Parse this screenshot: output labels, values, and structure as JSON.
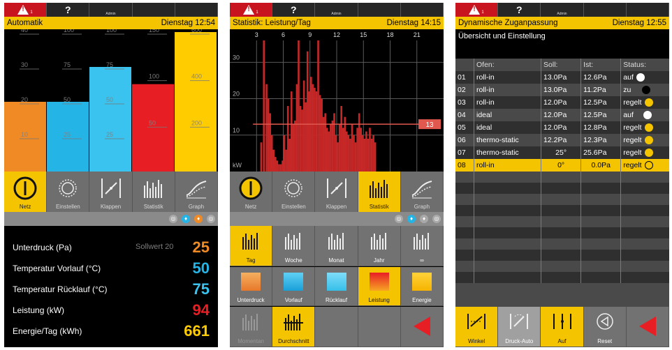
{
  "topbar": {
    "alert_sub": "1",
    "help": "?",
    "user": "Admin"
  },
  "colors": {
    "accent": "#f5c400",
    "orange": "#f08a24",
    "blue": "#25b4e6",
    "red": "#e81e25",
    "yellow": "#ffcc00"
  },
  "panel1": {
    "title": "Automatik",
    "datetime": "Dienstag 12:54",
    "bars": [
      {
        "label": "Unterdruck",
        "value": 20,
        "max": 40,
        "color": "#f08a24"
      },
      {
        "label": "Vorlauf",
        "value": 50,
        "max": 100,
        "color": "#25b4e6"
      },
      {
        "label": "Rücklauf",
        "value": 75,
        "max": 100,
        "color": "#39c3ee"
      },
      {
        "label": "Leistung",
        "value": 94,
        "max": 150,
        "color": "#e81e25"
      },
      {
        "label": "Energie",
        "value": 661,
        "max": 600,
        "color": "#ffcc00"
      }
    ],
    "bar_ticks": [
      [
        "10",
        "20",
        "30",
        "40"
      ],
      [
        "25",
        "50",
        "75",
        "100"
      ],
      [
        "25",
        "50",
        "75",
        "100"
      ],
      [
        "50",
        "100",
        "150"
      ],
      [
        "200",
        "400",
        "600"
      ]
    ],
    "nav": [
      "Netz",
      "Einstellen",
      "Klappen",
      "Statistik",
      "Graph"
    ],
    "values": [
      {
        "label": "Unterdruck (Pa)",
        "setpoint": "Sollwert 20",
        "value": "25",
        "color": "#f08a24"
      },
      {
        "label": "Temperatur Vorlauf (°C)",
        "setpoint": "",
        "value": "50",
        "color": "#25b4e6"
      },
      {
        "label": "Temperatur Rücklauf (°C)",
        "setpoint": "",
        "value": "75",
        "color": "#39c3ee"
      },
      {
        "label": "Leistung (kW)",
        "setpoint": "",
        "value": "94",
        "color": "#e81e25"
      },
      {
        "label": "Energie/Tag (kWh)",
        "setpoint": "",
        "value": "661",
        "color": "#ffcc00"
      }
    ]
  },
  "panel2": {
    "title": "Statistik: Leistung/Tag",
    "datetime": "Dienstag 14:15",
    "nav": [
      "Netz",
      "Einstellen",
      "Klappen",
      "Statistik",
      "Graph"
    ],
    "periods": [
      "Tag",
      "Woche",
      "Monat",
      "Jahr",
      "∞"
    ],
    "series": [
      "Unterdruck",
      "Vorlauf",
      "Rücklauf",
      "Leistung",
      "Energie"
    ],
    "modes": [
      "Momentan",
      "Durchschnitt"
    ],
    "chart_data": {
      "type": "bar",
      "x_ticks": [
        "3",
        "6",
        "9",
        "12",
        "15",
        "18",
        "21"
      ],
      "y_ticks": [
        "10",
        "20",
        "30"
      ],
      "ylabel": "kW",
      "xlim": [
        0,
        24
      ],
      "ylim": [
        0,
        36
      ],
      "average": 13,
      "average_label": "13",
      "x": [
        3.5,
        3.8,
        4.1,
        4.3,
        4.5,
        4.7,
        4.9,
        5.1,
        5.3,
        5.5,
        5.7,
        5.9,
        6.1,
        6.3,
        6.5,
        6.7,
        6.9,
        7.1,
        7.3,
        7.5,
        7.7,
        7.9,
        8.1,
        8.3,
        8.5,
        8.7,
        8.9,
        9.1,
        9.3,
        9.5,
        9.7,
        9.9,
        10.1,
        10.3,
        10.5,
        10.7,
        10.9,
        11.1,
        11.3,
        11.5,
        11.7,
        11.9,
        12.1,
        12.3,
        12.5,
        12.7,
        12.9,
        13.1,
        13.3,
        13.5,
        13.7,
        13.9,
        14.1,
        14.3,
        14.5,
        14.7,
        14.9,
        15.1,
        15.3,
        15.5,
        15.7,
        15.9,
        16.1,
        16.3
      ],
      "values": [
        8,
        36,
        24,
        20,
        16,
        10,
        6,
        4,
        3,
        2,
        2,
        3,
        10,
        6,
        18,
        9,
        22,
        13,
        14,
        24,
        36,
        18,
        17,
        25,
        19,
        33,
        22,
        26,
        24,
        23,
        22,
        36,
        21,
        20,
        15,
        16,
        12,
        11,
        13,
        14,
        16,
        10,
        8,
        13,
        18,
        12,
        15,
        11,
        10,
        9,
        13,
        10,
        8,
        12,
        16,
        12,
        10,
        9,
        11,
        9,
        12,
        9,
        10,
        8
      ]
    }
  },
  "panel3": {
    "title": "Dynamische Zuganpassung",
    "datetime": "Dienstag 12:55",
    "subtitle": "Übersicht und Einstellung",
    "columns": [
      "Ofen:",
      "Soll:",
      "Ist:",
      "Status:"
    ],
    "rows": [
      {
        "n": "01",
        "ofen": "roll-in",
        "soll": "13.0Pa",
        "ist": "12.6Pa",
        "status": "auf",
        "dot": "#ffffff"
      },
      {
        "n": "02",
        "ofen": "roll-in",
        "soll": "13.0Pa",
        "ist": "11.2Pa",
        "status": "zu",
        "dot": "#000000"
      },
      {
        "n": "03",
        "ofen": "roll-in",
        "soll": "12.0Pa",
        "ist": "12.5Pa",
        "status": "regelt",
        "dot": "#f5c400"
      },
      {
        "n": "04",
        "ofen": "ideal",
        "soll": "12.0Pa",
        "ist": "12.5Pa",
        "status": "auf",
        "dot": "#ffffff"
      },
      {
        "n": "05",
        "ofen": "ideal",
        "soll": "12.0Pa",
        "ist": "12.8Pa",
        "status": "regelt",
        "dot": "#f5c400"
      },
      {
        "n": "06",
        "ofen": "thermo-static",
        "soll": "12.2Pa",
        "ist": "12.3Pa",
        "status": "regelt",
        "dot": "#f5c400"
      },
      {
        "n": "07",
        "ofen": "thermo-static",
        "soll": "25°",
        "ist": "25.6Pa",
        "status": "regelt",
        "dot": "#f5c400"
      },
      {
        "n": "08",
        "ofen": "roll-in",
        "soll": "0°",
        "ist": "0.0Pa",
        "status": "regelt",
        "dot": "none"
      }
    ],
    "controls": [
      "Winkel",
      "Druck-Auto",
      "Auf",
      "Reset"
    ]
  }
}
